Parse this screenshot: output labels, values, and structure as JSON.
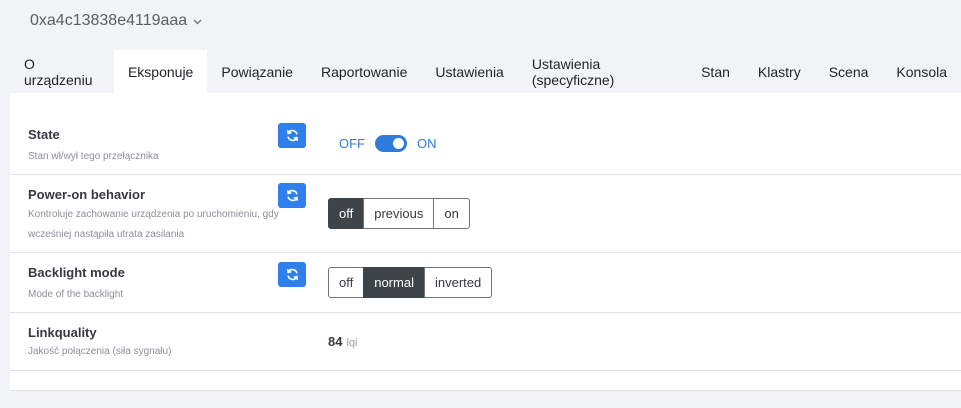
{
  "device": {
    "title": "0xa4c13838e4119aaa",
    "dropdown_icon": "chevron-down-icon"
  },
  "tabs": [
    {
      "label": "O urządzeniu"
    },
    {
      "label": "Eksponuje"
    },
    {
      "label": "Powiązanie"
    },
    {
      "label": "Raportowanie"
    },
    {
      "label": "Ustawienia"
    },
    {
      "label": "Ustawienia (specyficzne)"
    },
    {
      "label": "Stan"
    },
    {
      "label": "Klastry"
    },
    {
      "label": "Scena"
    },
    {
      "label": "Konsola"
    }
  ],
  "active_tab": "Eksponuje",
  "features": {
    "state": {
      "label": "State",
      "description": "Stan wł/wył tego przełącznika",
      "off_label": "OFF",
      "on_label": "ON",
      "value": "ON"
    },
    "power_on": {
      "label": "Power-on behavior",
      "description": "Kontroluje zachowanie urządzenia po uruchomieniu, gdy wcześniej nastąpiła utrata zasilania",
      "options": [
        "off",
        "previous",
        "on"
      ],
      "selected": "off"
    },
    "backlight": {
      "label": "Backlight mode",
      "description": "Mode of the backlight",
      "options": [
        "off",
        "normal",
        "inverted"
      ],
      "selected": "normal"
    },
    "linkquality": {
      "label": "Linkquality",
      "description": "Jakość połączenia (siła sygnału)",
      "value": "84",
      "unit": "lqi"
    }
  },
  "colors": {
    "accent": "#2f80ed",
    "selected_button": "#3f4449",
    "background": "#f1f3f6"
  }
}
